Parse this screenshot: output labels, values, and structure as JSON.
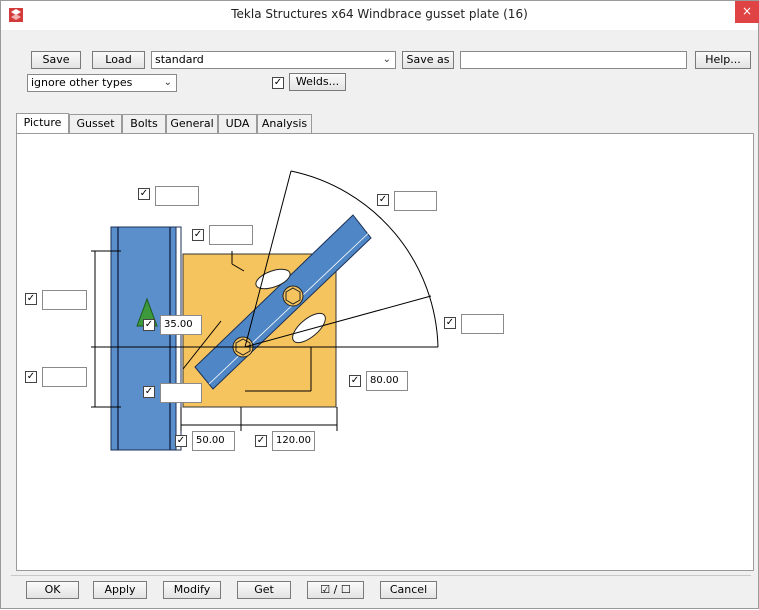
{
  "window": {
    "title": "Tekla Structures x64  Windbrace gusset plate (16)",
    "close_glyph": "×"
  },
  "toolbar": {
    "save_label": "Save",
    "load_label": "Load",
    "preset_value": "standard",
    "save_as_label": "Save as",
    "save_as_value": "",
    "help_label": "Help...",
    "filter_value": "ignore other types",
    "welds_checked": "✓",
    "welds_label": "Welds..."
  },
  "tabs": [
    {
      "label": "Picture"
    },
    {
      "label": "Gusset"
    },
    {
      "label": "Bolts"
    },
    {
      "label": "General"
    },
    {
      "label": "UDA"
    },
    {
      "label": "Analysis"
    }
  ],
  "picture": {
    "check": "✓",
    "values": {
      "top_left": "",
      "top_right": "",
      "mid_upper": "",
      "left_upper": "",
      "left_lower": "",
      "right_mid": "",
      "bottom_left": "",
      "dim_35": "35.00",
      "dim_80": "80.00",
      "dim_50": "50.00",
      "dim_120": "120.00"
    },
    "colors": {
      "column": "#5b8fcc",
      "plate": "#f6c45f",
      "brace": "#4f86c6"
    }
  },
  "footer": {
    "ok_label": "OK",
    "apply_label": "Apply",
    "modify_label": "Modify",
    "get_label": "Get",
    "toggle_label": "☑ / ☐",
    "cancel_label": "Cancel"
  }
}
